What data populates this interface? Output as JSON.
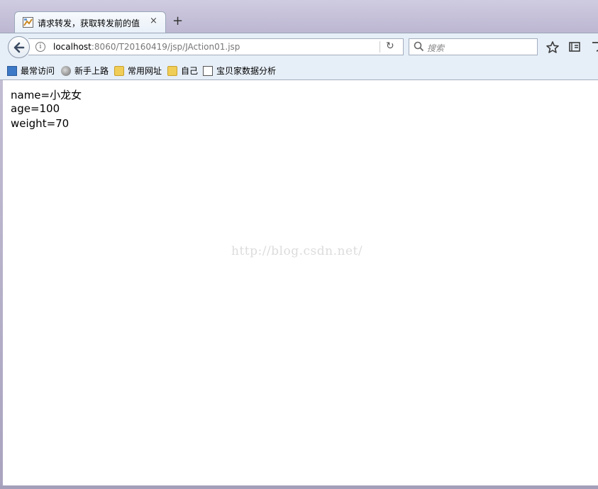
{
  "tab": {
    "title": "请求转发，获取转发前的值",
    "close_symbol": "×",
    "new_tab_symbol": "+"
  },
  "navbar": {
    "url_host": "localhost",
    "url_path": ":8060/T20160419/jsp/JAction01.jsp",
    "info_symbol": "i",
    "reload_symbol": "↻",
    "search_placeholder": "搜索"
  },
  "bookmarks": [
    {
      "label": "最常访问",
      "icon": "most-visited-icon"
    },
    {
      "label": "新手上路",
      "icon": "globe-icon"
    },
    {
      "label": "常用网址",
      "icon": "folder-icon"
    },
    {
      "label": "自己",
      "icon": "folder-icon"
    },
    {
      "label": "宝贝家数据分析",
      "icon": "image-icon"
    }
  ],
  "page": {
    "lines": [
      "name=小龙女",
      "age=100",
      "weight=70"
    ],
    "watermark": "http://blog.csdn.net/"
  }
}
